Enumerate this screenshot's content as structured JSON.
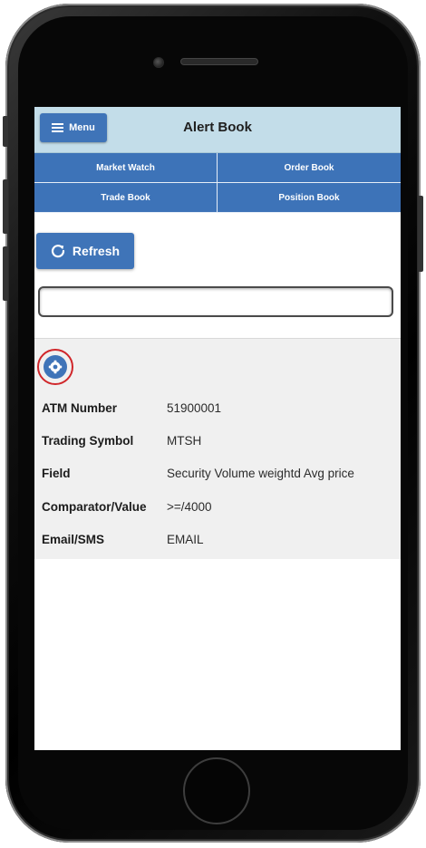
{
  "header": {
    "menu_label": "Menu",
    "title": "Alert Book"
  },
  "nav": {
    "tabs": [
      {
        "label": "Market Watch"
      },
      {
        "label": "Order Book"
      },
      {
        "label": "Trade Book"
      },
      {
        "label": "Position Book"
      }
    ]
  },
  "toolbar": {
    "refresh_label": "Refresh",
    "search_value": ""
  },
  "alert": {
    "settings_icon": "gear-icon",
    "fields": [
      {
        "label": "ATM Number",
        "value": "51900001"
      },
      {
        "label": "Trading Symbol",
        "value": "MTSH"
      },
      {
        "label": "Field",
        "value": "Security Volume weightd Avg price"
      },
      {
        "label": "Comparator/Value",
        "value": ">=/4000"
      },
      {
        "label": "Email/SMS",
        "value": "EMAIL"
      }
    ]
  },
  "colors": {
    "accent": "#3f74b8",
    "header_bg": "#c3dde9",
    "highlight_ring": "#d0262a"
  }
}
